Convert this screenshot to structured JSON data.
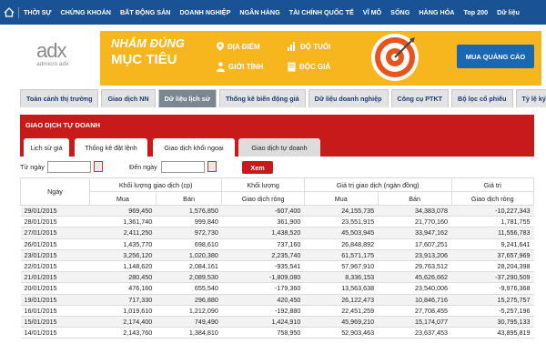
{
  "nav": {
    "items": [
      "THỜI SỰ",
      "CHỨNG KHOÁN",
      "BẤT ĐỘNG SẢN",
      "DOANH NGHIỆP",
      "NGÂN HÀNG",
      "TÀI CHÍNH QUỐC TẾ",
      "VĨ MÔ",
      "SỐNG",
      "HÀNG HÓA",
      "Top 200",
      "Dữ liệu"
    ]
  },
  "logo": {
    "brand": "adx",
    "brand_accent": "x",
    "sub": "admicro adx"
  },
  "banner": {
    "line1": "NHẮM ĐÚNG",
    "line2": "MỤC TIÊU",
    "opt1": "ĐỊA ĐIỂM",
    "opt2": "ĐỘ TUỔI",
    "opt3": "GIỚI TÍNH",
    "opt4": "ĐỘC GIẢ",
    "cta": "MUA QUẢNG CÁO"
  },
  "tabs": [
    "Toàn cảnh thị trường",
    "Giao dịch NN",
    "Dữ liệu lịch sử",
    "Thống kê biến động giá",
    "Dữ liệu doanh nghiệp",
    "Công cụ PTKT",
    "Bộ lọc cổ phiếu",
    "Tỷ lệ ký quỹ"
  ],
  "active_tab": 2,
  "section_title": "GIAO DỊCH TỰ DOANH",
  "subtabs": [
    "Lịch sử giá",
    "Thống kê đặt lệnh",
    "Giao dịch khối ngoại",
    "Giao dịch tự doanh"
  ],
  "filter": {
    "from_label": "Từ ngày",
    "to_label": "Đến ngày",
    "button": "Xem"
  },
  "table": {
    "h1": [
      "Ngày",
      "Khối lượng giao dịch (cp)",
      "Khối lượng",
      "Giá trị giao dịch (ngàn đồng)",
      "Giá trị"
    ],
    "h2": [
      "Mua",
      "Bán",
      "Giao dịch ròng",
      "Mua",
      "Bán",
      "Giao dịch ròng"
    ],
    "rows": [
      [
        "29/01/2015",
        "969,450",
        "1,576,850",
        "-607,400",
        "24,155,735",
        "34,383,078",
        "-10,227,343"
      ],
      [
        "28/01/2015",
        "1,361,740",
        "999,840",
        "361,900",
        "23,551,915",
        "21,770,160",
        "1,781,755"
      ],
      [
        "27/01/2015",
        "2,411,250",
        "972,730",
        "1,438,520",
        "45,503,945",
        "33,947,162",
        "11,556,783"
      ],
      [
        "26/01/2015",
        "1,435,770",
        "698,610",
        "737,160",
        "26,848,892",
        "17,607,251",
        "9,241,641"
      ],
      [
        "23/01/2015",
        "3,256,120",
        "1,020,380",
        "2,235,740",
        "61,571,175",
        "23,913,206",
        "37,657,969"
      ],
      [
        "22/01/2015",
        "1,148,620",
        "2,084,161",
        "-935,541",
        "57,967,910",
        "29,763,512",
        "28,204,398"
      ],
      [
        "21/01/2015",
        "280,450",
        "2,089,530",
        "-1,809,080",
        "8,336,153",
        "45,626,662",
        "-37,290,509"
      ],
      [
        "20/01/2015",
        "476,160",
        "655,540",
        "-179,360",
        "13,563,638",
        "23,540,006",
        "-9,976,368"
      ],
      [
        "19/01/2015",
        "717,330",
        "296,880",
        "420,450",
        "26,122,473",
        "10,846,716",
        "15,275,757"
      ],
      [
        "16/01/2015",
        "1,019,610",
        "1,212,090",
        "-192,880",
        "22,451,259",
        "27,708,455",
        "-5,257,196"
      ],
      [
        "15/01/2015",
        "2,174,400",
        "749,490",
        "1,424,910",
        "45,969,210",
        "15,174,077",
        "30,795,133"
      ],
      [
        "14/01/2015",
        "2,143,760",
        "1,384,810",
        "758,950",
        "52,903,463",
        "23,637,453",
        "43,895,819"
      ]
    ]
  }
}
